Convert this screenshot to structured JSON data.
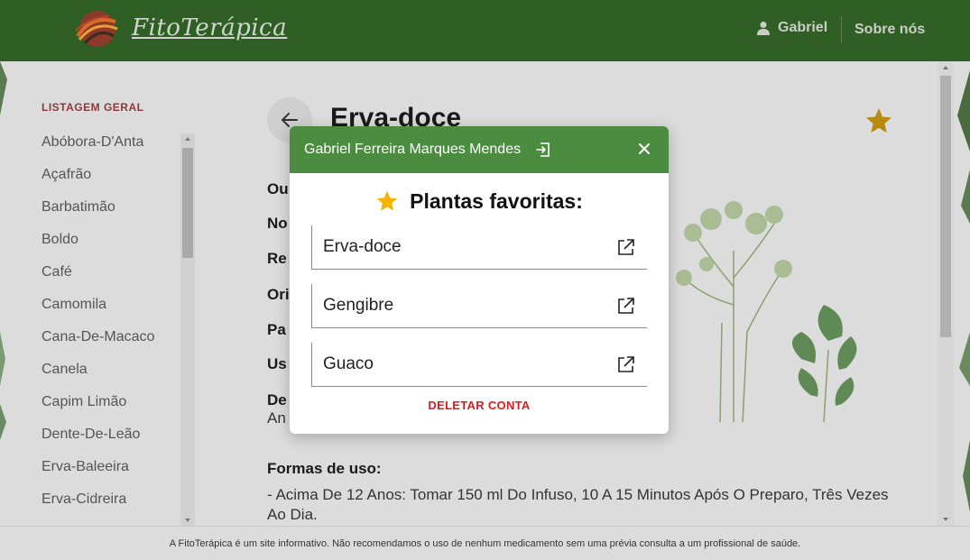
{
  "header": {
    "logo_text": "FitoTerápica",
    "user_name": "Gabriel",
    "about_label": "Sobre nós"
  },
  "sidebar": {
    "title": "LISTAGEM GERAL",
    "items": [
      {
        "label": "Abóbora-D'Anta"
      },
      {
        "label": "Açafrão"
      },
      {
        "label": "Barbatimão"
      },
      {
        "label": "Boldo"
      },
      {
        "label": "Café"
      },
      {
        "label": "Camomila"
      },
      {
        "label": "Cana-De-Macaco"
      },
      {
        "label": "Canela"
      },
      {
        "label": "Capim Limão"
      },
      {
        "label": "Dente-De-Leão"
      },
      {
        "label": "Erva-Baleeira"
      },
      {
        "label": "Erva-Cidreira"
      }
    ]
  },
  "main": {
    "title": "Erva-doce",
    "fields": [
      {
        "label": "Ou"
      },
      {
        "label": "No"
      },
      {
        "label": "Re"
      },
      {
        "label": "Ori"
      },
      {
        "label": "Pa"
      },
      {
        "label": "Us"
      },
      {
        "label": "De"
      }
    ],
    "description_start": "An",
    "usage_title": "Formas de uso:",
    "usage_text": "- Acima De 12 Anos: Tomar 150 ml Do Infuso, 10 A 15 Minutos Após O Preparo, Três Vezes Ao Dia."
  },
  "modal": {
    "user_full_name": "Gabriel Ferreira Marques Mendes",
    "title": "Plantas favoritas:",
    "favorites": [
      {
        "name": "Erva-doce"
      },
      {
        "name": "Gengibre"
      },
      {
        "name": "Guaco"
      }
    ],
    "delete_label": "DELETAR CONTA"
  },
  "footer": {
    "text": "A FitoTerápica é um site informativo. Não recomendamos o uso de nenhum medicamento sem uma prévia consulta a um profissional de saúde."
  },
  "colors": {
    "header_bg": "#2f5f24",
    "modal_header_bg": "#4c8c40",
    "star": "#f5b400",
    "delete": "#e01b1b"
  }
}
